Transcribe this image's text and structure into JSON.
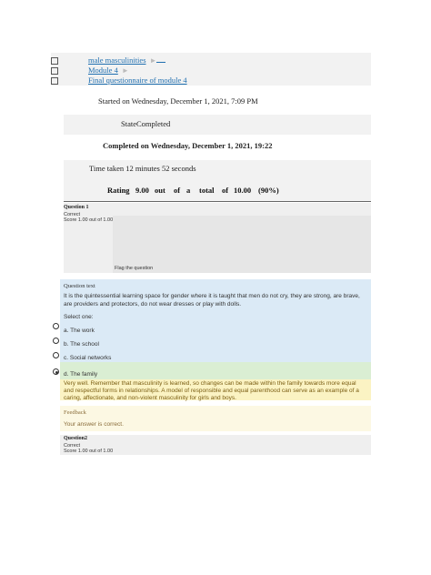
{
  "breadcrumb": {
    "items": [
      {
        "label": "male masculinities"
      },
      {
        "label": "Module 4"
      },
      {
        "label": "Final questionnaire of module 4"
      }
    ],
    "arrow": "►"
  },
  "summary": {
    "started": "Started on Wednesday, December 1, 2021, 7:09 PM",
    "state": "StateCompleted",
    "completed": "Completed on Wednesday, December 1, 2021, 19:22",
    "time_taken": "Time taken 12 minutes 52 seconds",
    "rating": [
      "Rating",
      "9.00",
      "out",
      "of",
      "a",
      "total",
      "of",
      "10.00",
      "(90%)"
    ]
  },
  "question1": {
    "title": "Question 1",
    "status": "Correct",
    "score": "Score 1.00 out of 1.00",
    "flag": "Flag the question",
    "text_label": "Question text",
    "text": "It is the quintessential learning space for gender where it is taught that men do not cry, they are strong, are brave, are providers and protectors, do not wear dresses or play with dolls.",
    "select_label": "Select one:",
    "options": [
      {
        "label": "a. The work",
        "selected": false
      },
      {
        "label": "b. The school",
        "selected": false
      },
      {
        "label": "c. Social networks",
        "selected": false
      },
      {
        "label": "d. The family",
        "selected": true
      }
    ],
    "explanation": "Very well. Remember that masculinity is learned, so changes can be made within the family towards more equal and respectful forms in relationships. A model of responsible and equal parenthood can serve as an example of a caring, affectionate, and non-violent masculinity for girls and boys.",
    "feedback_title": "Feedback",
    "feedback_text": "Your answer is correct."
  },
  "question2": {
    "title": "Question2",
    "status": "Correct",
    "score": "Score 1.00 out of 1.00"
  },
  "colors": {
    "link": "#1f6fb0",
    "question_text_bg": "#dbeaf6",
    "correct_bg": "#daeed3",
    "explanation_bg": "#fbf3c3",
    "feedback_bg": "#fcf8e3"
  }
}
